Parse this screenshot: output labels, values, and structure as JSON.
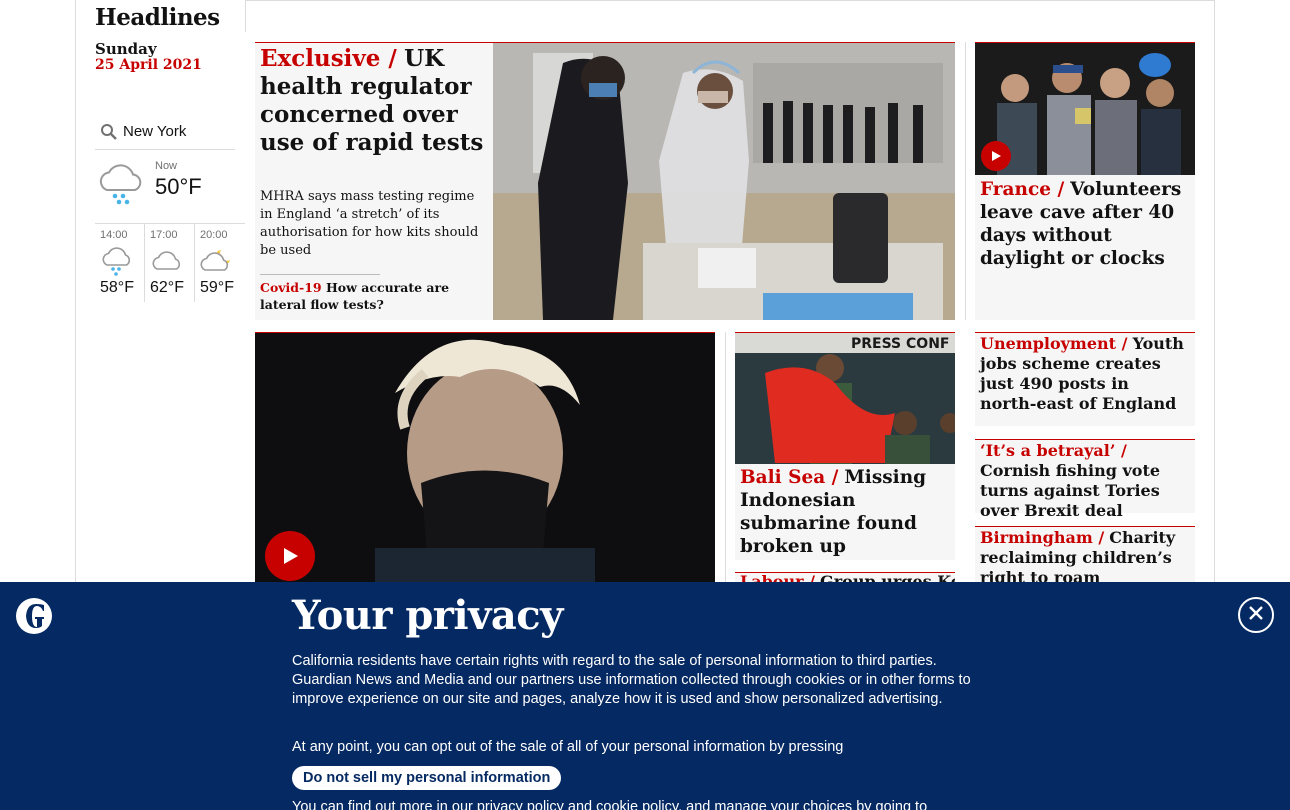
{
  "sidebar": {
    "title": "Headlines",
    "day": "Sunday",
    "date": "25 April 2021",
    "weather": {
      "location": "New York",
      "now_label": "Now",
      "now_temp": "50°F",
      "now_icon": "rain-cloud-icon",
      "forecast": [
        {
          "time": "14:00",
          "temp": "58°F",
          "icon": "rain-cloud-icon"
        },
        {
          "time": "17:00",
          "temp": "62°F",
          "icon": "cloud-icon"
        },
        {
          "time": "20:00",
          "temp": "59°F",
          "icon": "moon-cloud-icon"
        }
      ]
    }
  },
  "hero": {
    "kicker": "Exclusive /",
    "headline": "UK health regulator concerned over use of rapid tests",
    "standfirst": "MHRA says mass testing regime in England ‘a stretch’ of its authorisation for how kits should be used",
    "related_kicker": "Covid-19",
    "related_headline": "How accurate are lateral flow tests?"
  },
  "cards": {
    "france": {
      "kicker": "France /",
      "headline": "Volunteers leave cave after 40 days without daylight or clocks"
    },
    "unemployment": {
      "kicker": "Unemployment /",
      "headline": "Youth jobs scheme creates just 490 posts in north-east of England"
    },
    "betrayal": {
      "kicker": "‘It’s a betrayal’ /",
      "headline": "Cornish fishing vote turns against Tories over Brexit deal"
    },
    "birmingham": {
      "kicker": "Birmingham /",
      "headline": "Charity reclaiming children’s right to roam"
    },
    "balisea": {
      "kicker": "Bali Sea /",
      "headline": "Missing Indonesian submarine found broken up",
      "image_text": "PRESS CONF"
    },
    "labour": {
      "kicker": "Labour /",
      "headline": "Group urges Keir"
    }
  },
  "privacy": {
    "title": "Your privacy",
    "body": "California residents have certain rights with regard to the sale of personal information to third parties. Guardian News and Media and our partners use information collected through cookies or in other forms to improve experience on our site and pages, analyze how it is used and show personalized advertising.",
    "line2": "At any point, you can opt out of the sale of all of your personal information by pressing",
    "button": "Do not sell my personal information",
    "more": "You can find out more in our privacy policy and cookie policy, and manage your choices by going to",
    "logo_icon": "guardian-logo-icon",
    "close_icon": "close-icon"
  },
  "colors": {
    "accent": "#c70000",
    "brand": "#052962",
    "card_bg": "#f6f6f6"
  }
}
